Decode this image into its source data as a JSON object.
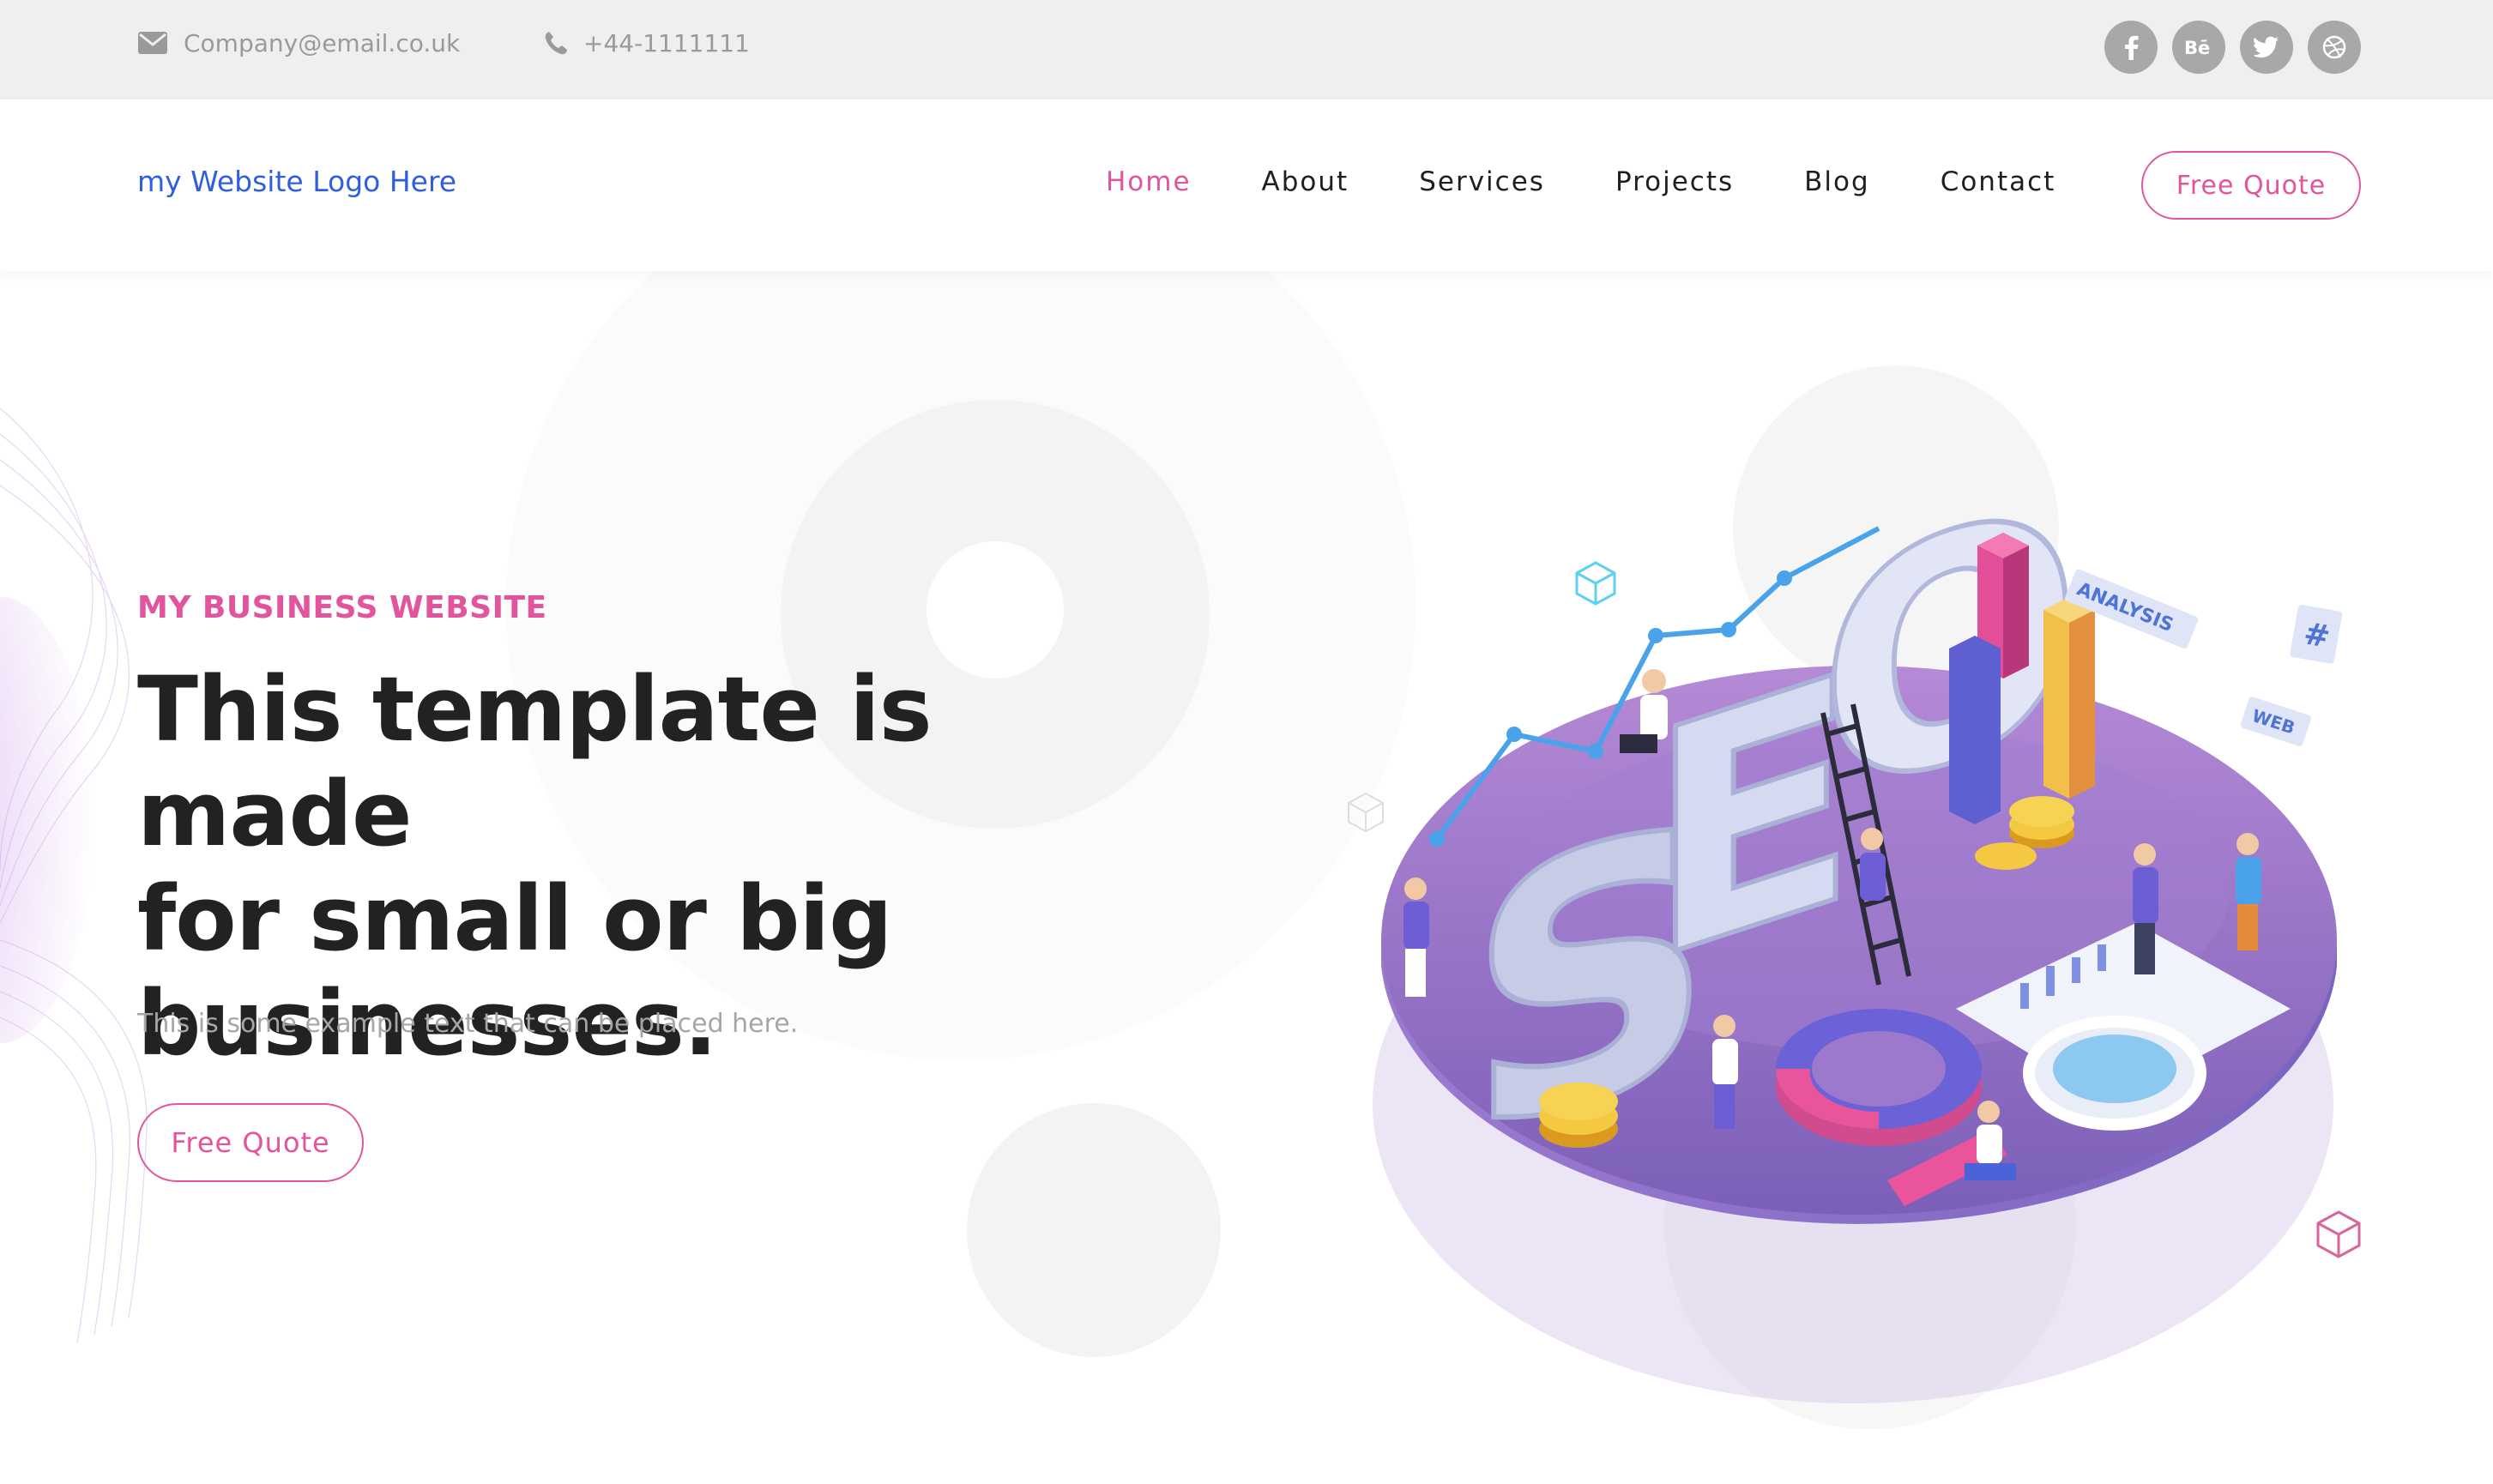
{
  "topbar": {
    "email": "Company@email.co.uk",
    "phone": "+44-1111111",
    "socials": [
      {
        "name": "facebook-icon",
        "glyph": "f"
      },
      {
        "name": "behance-icon",
        "glyph": "Bē"
      },
      {
        "name": "twitter-icon",
        "glyph": "bird"
      },
      {
        "name": "dribbble-icon",
        "glyph": "ball"
      }
    ]
  },
  "nav": {
    "logo": "my Website Logo Here",
    "items": [
      "Home",
      "About",
      "Services",
      "Projects",
      "Blog",
      "Contact"
    ],
    "active": "Home",
    "cta": "Free Quote"
  },
  "hero": {
    "kicker": "MY BUSINESS WEBSITE",
    "headline_line1": "This template is made",
    "headline_line2": "for small or big",
    "headline_line3": "businesses.",
    "text": "This is some example text that can be placed here.",
    "cta": "Free Quote"
  },
  "illustration": {
    "big_word": "SEO",
    "tags": [
      "ANALYSIS",
      "WEB",
      "#"
    ]
  },
  "colors": {
    "accent": "#e2559c",
    "logo": "#2f5fe0",
    "heading": "#222222",
    "topbar_bg": "#efefef",
    "platform": "#8b6bc0"
  }
}
